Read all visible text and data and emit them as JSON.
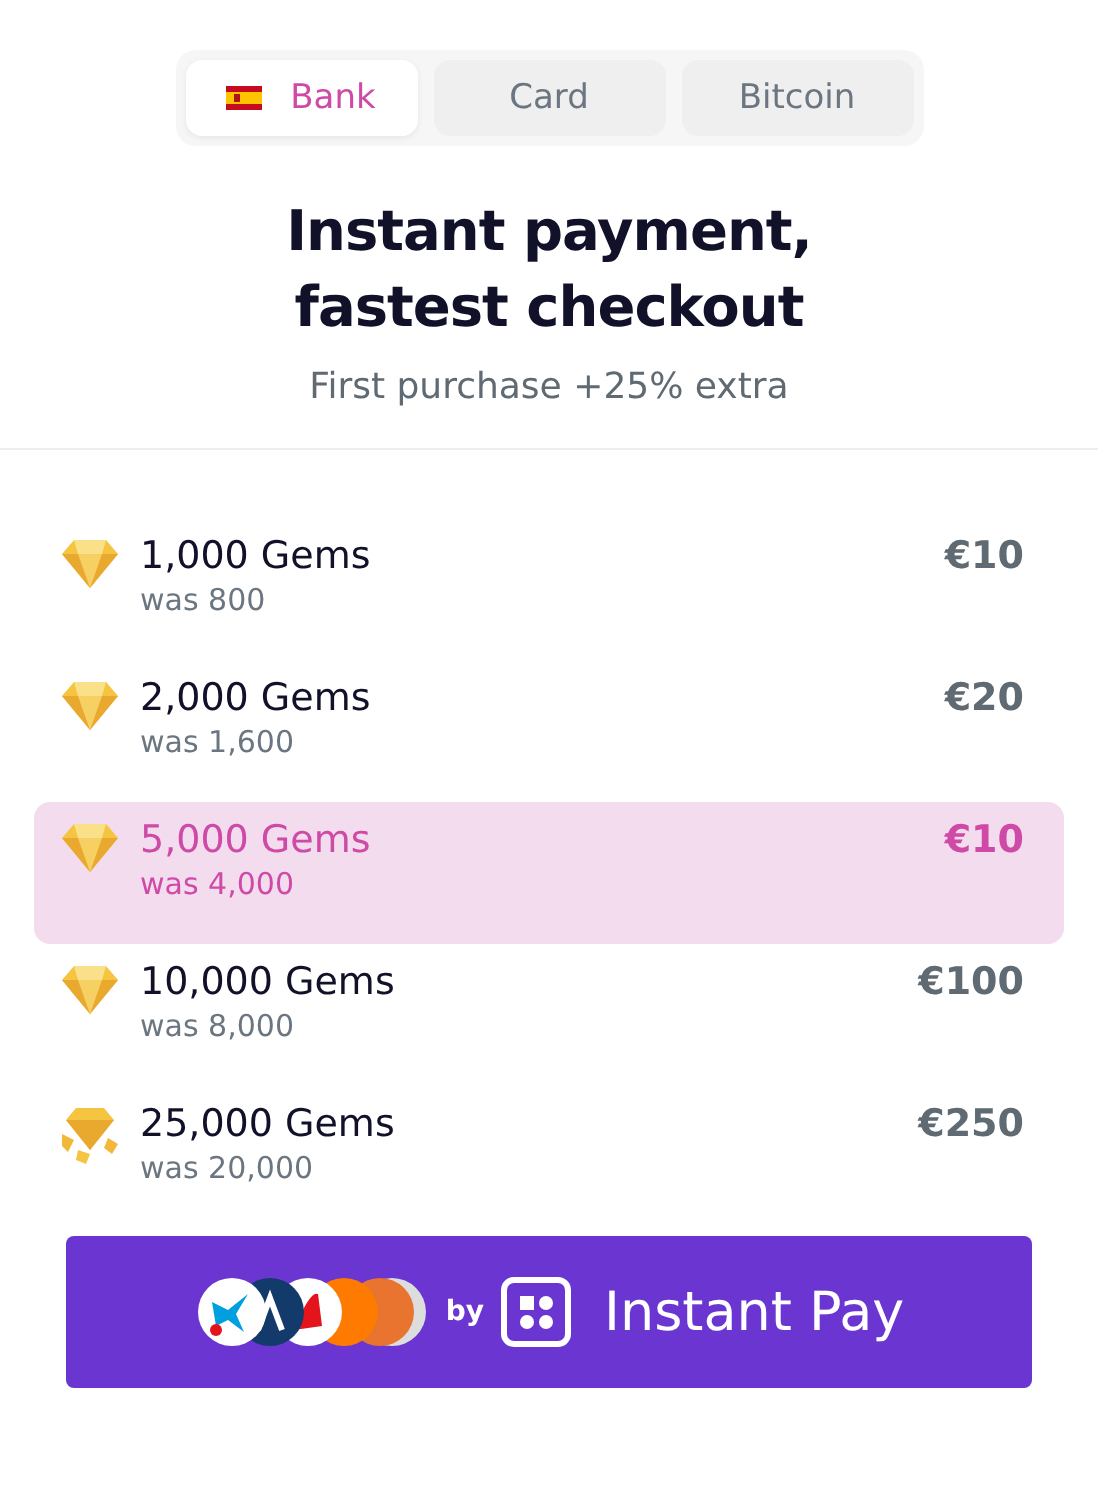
{
  "tabs": [
    {
      "label": "Bank",
      "flag": true,
      "selected": true
    },
    {
      "label": "Card",
      "flag": false,
      "selected": false
    },
    {
      "label": "Bitcoin",
      "flag": false,
      "selected": false
    }
  ],
  "heading": "Instant payment,\nfastest checkout",
  "subtitle": "First purchase +25% extra",
  "offers": [
    {
      "kind": "gem",
      "name": "1,000 Gems",
      "was": "was 800",
      "price": "€10",
      "selected": false
    },
    {
      "kind": "gem",
      "name": "2,000 Gems",
      "was": "was 1,600",
      "price": "€20",
      "selected": false
    },
    {
      "kind": "gem",
      "name": "5,000 Gems",
      "was": "was 4,000",
      "price": "€10",
      "selected": true
    },
    {
      "kind": "gem",
      "name": "10,000 Gems",
      "was": "was 8,000",
      "price": "€100",
      "selected": false
    },
    {
      "kind": "gem-pile",
      "name": "25,000 Gems",
      "was": "was 20,000",
      "price": "€250",
      "selected": false
    }
  ],
  "pay_button": {
    "by": "by",
    "label": "Instant Pay"
  }
}
